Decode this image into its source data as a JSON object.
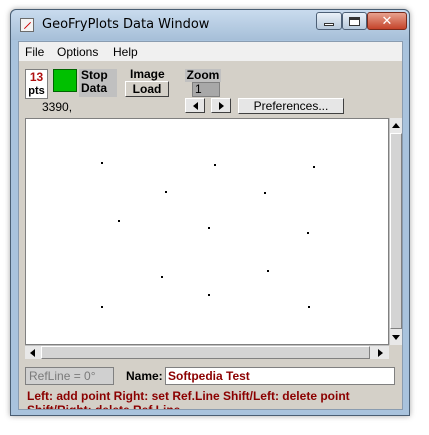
{
  "window": {
    "title": "GeoFryPlots Data Window"
  },
  "menu": [
    "File",
    "Options",
    "Help"
  ],
  "toolbar": {
    "count": "13",
    "count_unit": "pts",
    "status_color": "#00c000",
    "stop_label_1": "Stop",
    "stop_label_2": "Data",
    "coords": "3390,",
    "image_label": "Image",
    "load_label": "Load",
    "zoom_label": "Zoom",
    "zoom_value": "1",
    "preferences_label": "Preferences..."
  },
  "plot": {
    "point_color": "#000000",
    "point_count": 13
  },
  "status": {
    "refline": "RefLine = 0°",
    "name_label": "Name:",
    "name_value": "Softpedia Test",
    "hint1": "Left: add point  Right: set Ref.Line  Shift/Left: delete point",
    "hint2": "Shift/Right: delete Ref.Line"
  }
}
